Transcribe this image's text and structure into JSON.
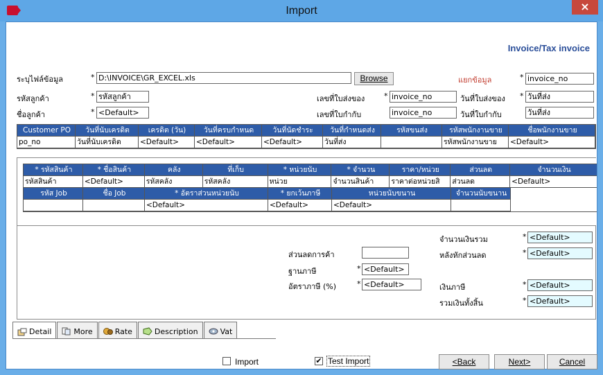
{
  "window": {
    "title": "Import",
    "close_glyph": "×"
  },
  "heading": "Invoice/Tax invoice",
  "top": {
    "file_label": "ระบุไฟล์ข้อมูล",
    "file_value": "D:\\INVOICE\\GR_EXCEL.xls",
    "browse_label": "Browse",
    "split_label": "แยกข้อมูล",
    "split_value": "invoice_no",
    "customer_code_label": "รหัสลูกค้า",
    "customer_code_value": "รหัสลูกค้า",
    "customer_name_label": "ชื่อลูกค้า",
    "customer_name_value": "<Default>",
    "delivery_no_label": "เลขที่ใบส่งของ",
    "delivery_no_value": "invoice_no",
    "delivery_date_label": "วันที่ใบส่งของ",
    "delivery_date_value": "วันที่ส่ง",
    "tax_no_label": "เลขที่ใบกำกับ",
    "tax_no_value": "invoice_no",
    "tax_date_label": "วันที่ใบกำกับ",
    "tax_date_value": "วันที่ส่ง",
    "asterisk": "*"
  },
  "grid1": {
    "headers": [
      "Customer PO",
      "วันที่นับเครดิต",
      "เครดิต (วัน)",
      "วันที่ครบกำหนด",
      "วันที่นัดชำระ",
      "วันที่กำหนดส่ง",
      "รหัสขนส่ง",
      "รหัสพนักงานขาย",
      "ชื่อพนักงานขาย"
    ],
    "values": [
      "po_no",
      "วันที่นับเครดิต",
      "<Default>",
      "<Default>",
      "<Default>",
      "วันที่ส่ง",
      "",
      "รหัสพนักงานขาย",
      "<Default>"
    ]
  },
  "grid2": {
    "headers": [
      "* รหัสสินค้า",
      "*  ชื่อสินค้า",
      "คลัง",
      "ที่เก็บ",
      "*  หน่วยนับ",
      "* จำนวน",
      "ราคา/หน่วย",
      "ส่วนลด",
      "จำนวนเงิน"
    ],
    "values": [
      "รหัสสินค้า",
      "<Default>",
      "รหัสคลัง",
      "รหัสคลัง",
      "หน่วย",
      "จำนวนสินค้า",
      "ราคาต่อหน่วยสิ",
      "ส่วนลด",
      "<Default>"
    ],
    "headers2": [
      "รหัส Job",
      "ชื่อ Job",
      "* อัตราส่วนหน่วยนับ",
      "* ยกเว้นภาษี",
      "หน่วยนับขนาน",
      "จำนวนนับขนาน"
    ],
    "values2": [
      "",
      "",
      "<Default>",
      "<Default>",
      "<Default>",
      ""
    ]
  },
  "summary": {
    "total_label": "จำนวนเงินรวม",
    "total_value": "<Default>",
    "after_discount_label": "หลังหักส่วนลด",
    "after_discount_value": "<Default>",
    "trade_discount_label": "ส่วนลดการค้า",
    "trade_discount_value": "",
    "tax_base_label": "ฐานภาษี",
    "tax_base_value": "<Default>",
    "tax_rate_label": "อัตราภาษี (%)",
    "tax_rate_value": "<Default>",
    "tax_amount_label": "เงินภาษี",
    "tax_amount_value": "<Default>",
    "grand_total_label": "รวมเงินทั้งสิ้น",
    "grand_total_value": "<Default>"
  },
  "tabs": [
    "Detail",
    "More",
    "Rate",
    "Description",
    "Vat"
  ],
  "footer": {
    "import_label": "Import",
    "test_import_label": "Test Import",
    "back_label": "<Back",
    "next_label": "Next>",
    "cancel_label": "Cancel",
    "check_glyph": "✔"
  }
}
